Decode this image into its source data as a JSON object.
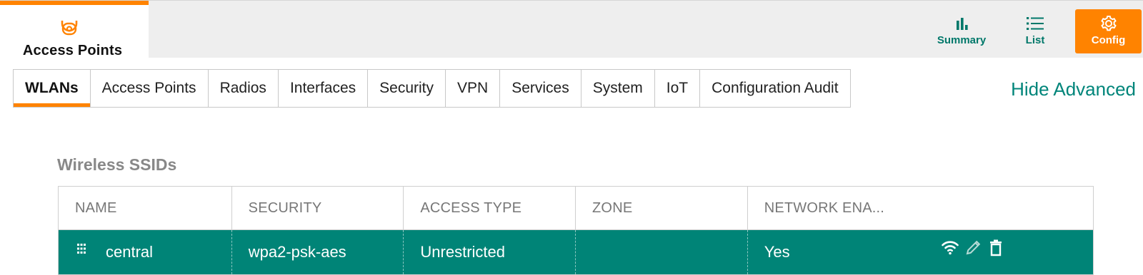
{
  "header": {
    "app_title": "Access Points",
    "app_icon": "access-point-icon",
    "nav": [
      {
        "label": "Summary",
        "icon": "bar-chart-icon"
      },
      {
        "label": "List",
        "icon": "list-icon"
      },
      {
        "label": "Config",
        "icon": "gear-icon",
        "active": true
      }
    ],
    "accent_color": "#ff8300",
    "teal_color": "#00786a"
  },
  "tabs": [
    {
      "label": "WLANs",
      "active": true
    },
    {
      "label": "Access Points"
    },
    {
      "label": "Radios"
    },
    {
      "label": "Interfaces"
    },
    {
      "label": "Security"
    },
    {
      "label": "VPN"
    },
    {
      "label": "Services"
    },
    {
      "label": "System"
    },
    {
      "label": "IoT"
    },
    {
      "label": "Configuration Audit"
    }
  ],
  "hide_advanced_label": "Hide Advanced",
  "section_title": "Wireless SSIDs",
  "table": {
    "columns": [
      "NAME",
      "SECURITY",
      "ACCESS TYPE",
      "ZONE",
      "NETWORK ENA..."
    ],
    "rows": [
      {
        "name": "central",
        "security": "wpa2-psk-aes",
        "access_type": "Unrestricted",
        "zone": "",
        "network_enabled": "Yes",
        "selected": true,
        "row_color": "#008477"
      }
    ],
    "row_action_icons": [
      "wifi-icon",
      "pencil-icon",
      "trash-icon"
    ]
  }
}
